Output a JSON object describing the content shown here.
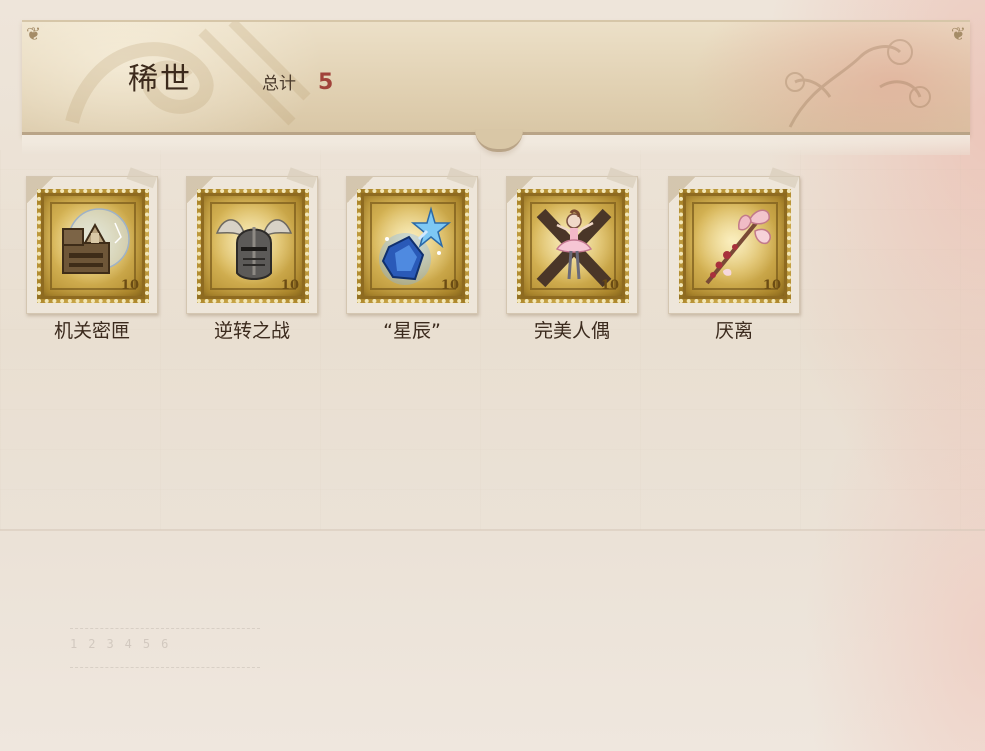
{
  "category": {
    "title": "稀世",
    "total_label": "总计",
    "total_count": "5"
  },
  "stamps": [
    {
      "name": "机关密匣",
      "value": "10",
      "icon": "mechanical-box-icon"
    },
    {
      "name": "逆转之战",
      "value": "10",
      "icon": "winged-helmet-icon"
    },
    {
      "name": "“星辰”",
      "value": "10",
      "icon": "star-crystal-icon"
    },
    {
      "name": "完美人偶",
      "value": "10",
      "icon": "ballerina-doll-icon"
    },
    {
      "name": "厌离",
      "value": "10",
      "icon": "cherry-blossom-staff-icon"
    }
  ],
  "ruler_digits": "123456",
  "colors": {
    "count_accent": "#a1423a",
    "stamp_gold": "#d9b85a",
    "header_bg": "#e2d2b4"
  }
}
